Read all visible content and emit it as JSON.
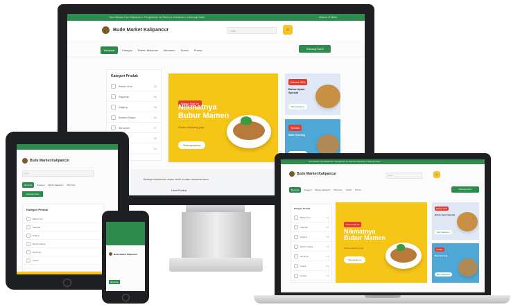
{
  "topbar": {
    "text": "Toko Bahan Kue Makanan • Pengiriman ke Seluruh Indonesia • Hubungi Kami",
    "right": "Masuk / Daftar"
  },
  "brand": {
    "name": "Bude Market Kalipancur"
  },
  "search": {
    "placeholder": "Cari..."
  },
  "nav": {
    "active": "Beranda",
    "items": [
      "Kategori",
      "Bahan Makanan",
      "Minuman",
      "Snack",
      "Promo"
    ],
    "cta": "Hubungi Kami"
  },
  "categories": {
    "title": "Kategori Produk",
    "items": [
      {
        "label": "Bahan Kue",
        "count": "12"
      },
      {
        "label": "Sayuran",
        "count": "08"
      },
      {
        "label": "Daging",
        "count": "05"
      },
      {
        "label": "Bumbu Dapur",
        "count": "10"
      },
      {
        "label": "Minuman",
        "count": "07"
      },
      {
        "label": "Snack",
        "count": "09"
      },
      {
        "label": "Frozen",
        "count": "04"
      }
    ]
  },
  "hero": {
    "badge": "Promo Hari Ini",
    "title": "Nikmatnya Bubur Mamen",
    "subtitle": "Pesan sekarang juga",
    "button": "Selengkapnya"
  },
  "promos": [
    {
      "badge": "Diskon 20%",
      "title": "Bubur Ayam Spesial",
      "button": "Beli Sekarang"
    },
    {
      "badge": "Terlaris",
      "title": "Nasi Goreng",
      "button": "Beli Sekarang"
    }
  ],
  "footer_text": "Belanja kebutuhan dapur lebih mudah bersama kami",
  "footer_more": "Lihat Produk",
  "colors": {
    "brand_green": "#2f8a4e",
    "hero_yellow": "#f5c518",
    "badge_red": "#e23d2f"
  }
}
